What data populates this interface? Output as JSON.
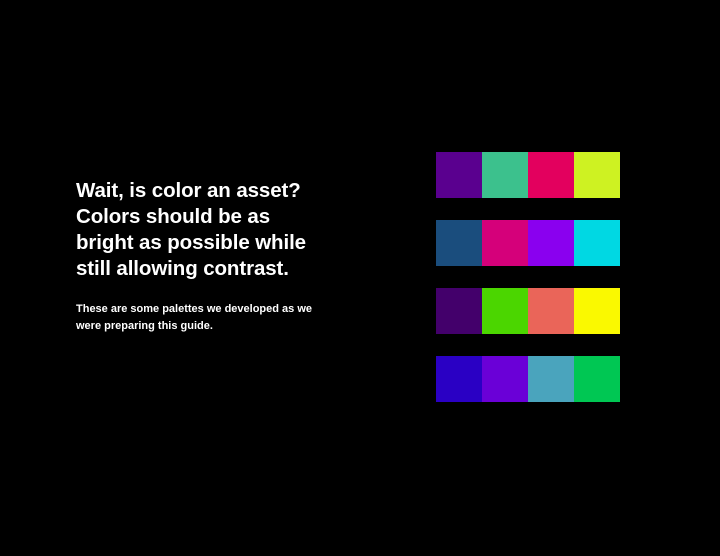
{
  "headline": {
    "lines": [
      "Wait, is color an asset?",
      "Colors should be as",
      "bright as possible while",
      "still allowing contrast."
    ]
  },
  "subtext": {
    "lines": [
      "These are some palettes we developed as we",
      "were preparing this guide."
    ]
  },
  "palettes": [
    [
      "#5a008f",
      "#3cc18d",
      "#e3005e",
      "#cef222"
    ],
    [
      "#1a4d7d",
      "#d5007a",
      "#8a00ef",
      "#00d8e3"
    ],
    [
      "#43006b",
      "#4bd600",
      "#ea6559",
      "#faf900"
    ],
    [
      "#2a00c4",
      "#6a00d7",
      "#4aa4bd",
      "#00c753"
    ]
  ]
}
